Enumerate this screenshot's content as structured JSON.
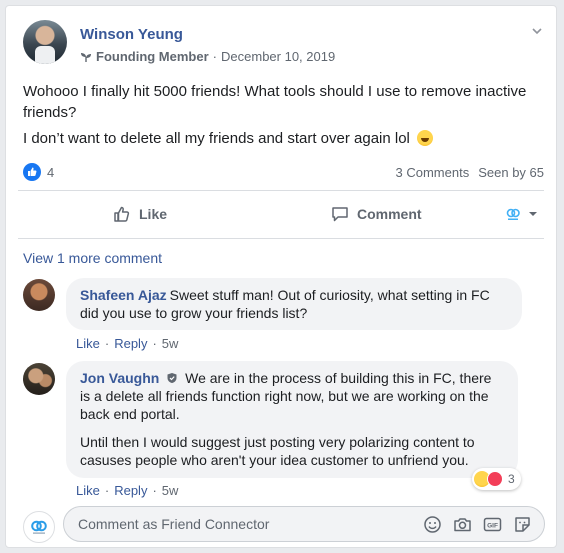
{
  "post": {
    "author": "Winson Yeung",
    "badge": "Founding Member",
    "separator": "·",
    "date": "December 10, 2019",
    "text_line1": "Wohooo I finally hit 5000 friends! What tools should I use to remove inactive friends?",
    "text_line2": "I don’t want to delete all my friends and start over again lol",
    "like_count": "4",
    "comments_count": "3 Comments",
    "seen_by": "Seen by 65"
  },
  "actions": {
    "like_label": "Like",
    "comment_label": "Comment"
  },
  "comments": {
    "view_more": "View 1 more comment",
    "items": [
      {
        "author": "Shafeen Ajaz",
        "text": "Sweet stuff man! Out of curiosity, what setting in FC did you use to grow your friends list?",
        "like": "Like",
        "reply": "Reply",
        "sep": "·",
        "time": "5w"
      },
      {
        "author": "Jon Vaughn",
        "text_para1": "We are in the process of building this in FC, there is a delete all friends function right now, but we are working on the back end portal.",
        "text_para2": "Until then I would suggest just posting very polarizing content to casuses people who aren't your idea customer to unfriend you.",
        "like": "Like",
        "reply": "Reply",
        "sep": "·",
        "time": "5w",
        "reaction_count": "3"
      }
    ]
  },
  "composer": {
    "placeholder": "Comment as Friend Connector",
    "icons": [
      "emoji-icon",
      "camera-icon",
      "gif-icon",
      "sticker-icon"
    ]
  },
  "colors": {
    "link": "#385898",
    "facebook_blue": "#1877f2",
    "muted": "#606770"
  }
}
